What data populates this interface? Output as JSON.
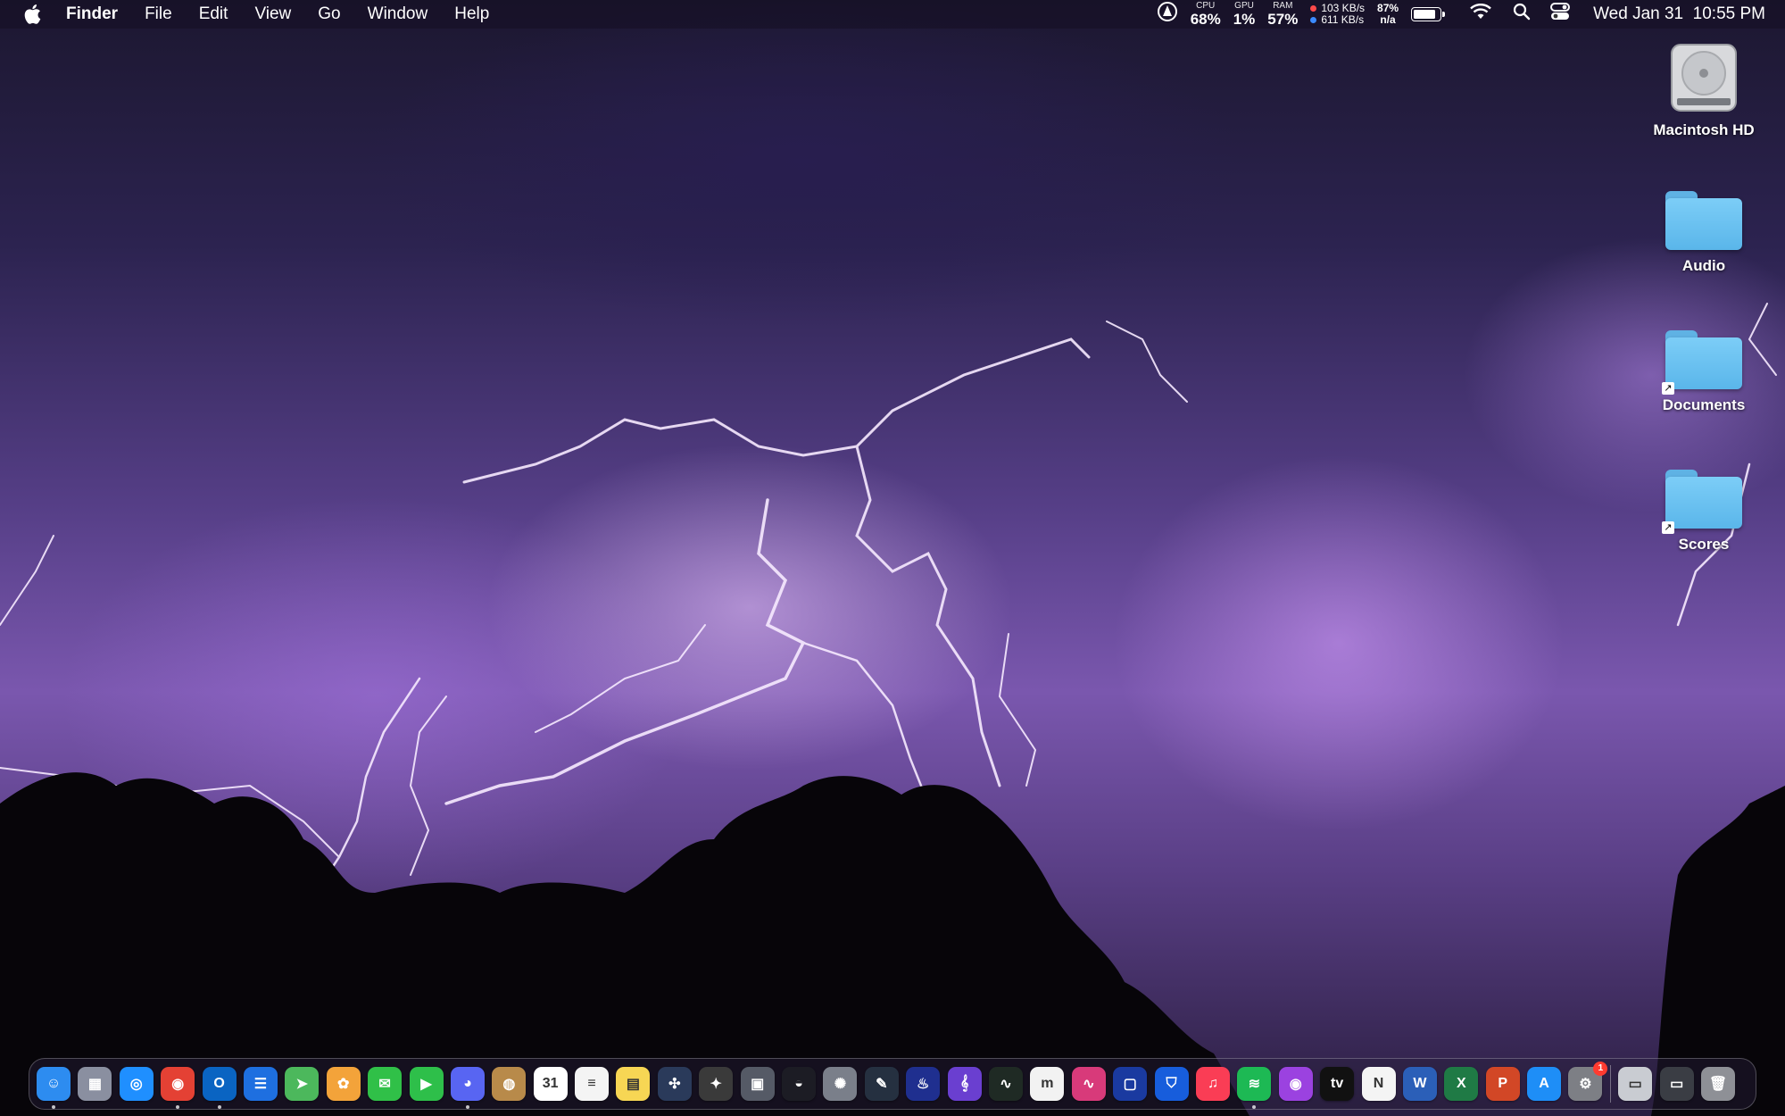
{
  "menubar": {
    "app_name": "Finder",
    "menus": [
      "File",
      "Edit",
      "View",
      "Go",
      "Window",
      "Help"
    ],
    "status": {
      "cpu_label": "CPU",
      "cpu_value": "68%",
      "gpu_label": "GPU",
      "gpu_value": "1%",
      "ram_label": "RAM",
      "ram_value": "57%",
      "net_up": "103 KB/s",
      "net_down": "611 KB/s",
      "battery_percent": "87%",
      "battery_time": "n/a",
      "battery_level": 0.87,
      "clock": "Wed Jan 31  10:55 PM"
    }
  },
  "desktop": {
    "icons": [
      {
        "label": "Macintosh HD",
        "icon": "hard-drive-icon"
      },
      {
        "label": "Audio",
        "icon": "folder-icon"
      },
      {
        "label": "Documents",
        "icon": "folder-alias-icon"
      },
      {
        "label": "Scores",
        "icon": "folder-alias-icon"
      }
    ]
  },
  "dock": {
    "apps": [
      {
        "name": "finder",
        "glyph": "☺",
        "color": "#2d8cf0",
        "running": true
      },
      {
        "name": "launchpad",
        "glyph": "▦",
        "color": "#8a8fa0",
        "running": false
      },
      {
        "name": "safari",
        "glyph": "◎",
        "color": "#1f8fff",
        "running": false
      },
      {
        "name": "chrome",
        "glyph": "◉",
        "color": "#e44134",
        "running": true
      },
      {
        "name": "outlook",
        "glyph": "O",
        "color": "#0a64c2",
        "running": true
      },
      {
        "name": "files",
        "glyph": "☰",
        "color": "#1e6fe0",
        "running": false
      },
      {
        "name": "maps",
        "glyph": "➤",
        "color": "#4cb85c",
        "running": false
      },
      {
        "name": "photos",
        "glyph": "✿",
        "color": "#f3a33a",
        "running": false
      },
      {
        "name": "messages",
        "glyph": "✉",
        "color": "#30c048",
        "running": false
      },
      {
        "name": "facetime",
        "glyph": "▶",
        "color": "#2ebf4a",
        "running": false
      },
      {
        "name": "discord",
        "glyph": "◕",
        "color": "#5865f2",
        "running": true
      },
      {
        "name": "archive",
        "glyph": "◍",
        "color": "#b88a4a",
        "running": false
      },
      {
        "name": "calendar",
        "glyph": "31",
        "color": "#ffffff",
        "running": false
      },
      {
        "name": "reminders",
        "glyph": "≡",
        "color": "#f4f4f4",
        "running": false
      },
      {
        "name": "notes",
        "glyph": "▤",
        "color": "#f7d654",
        "running": false
      },
      {
        "name": "davinci-resolve",
        "glyph": "✣",
        "color": "#2a3a5a",
        "running": false
      },
      {
        "name": "motion",
        "glyph": "✦",
        "color": "#3a3a3a",
        "running": false
      },
      {
        "name": "compressor",
        "glyph": "▣",
        "color": "#555a66",
        "running": false
      },
      {
        "name": "obs",
        "glyph": "◒",
        "color": "#1c1c24",
        "running": false
      },
      {
        "name": "fan-control",
        "glyph": "✺",
        "color": "#7a7f8a",
        "running": false
      },
      {
        "name": "logic-pro",
        "glyph": "✎",
        "color": "#253040",
        "running": false
      },
      {
        "name": "audio-app",
        "glyph": "♨",
        "color": "#1f2f8f",
        "running": false
      },
      {
        "name": "musescore",
        "glyph": "𝄞",
        "color": "#6a3fd0",
        "running": false
      },
      {
        "name": "activity-monitor",
        "glyph": "∿",
        "color": "#1f2a24",
        "running": false
      },
      {
        "name": "m-app",
        "glyph": "m",
        "color": "#f2f2f2",
        "running": false
      },
      {
        "name": "waveform-app",
        "glyph": "∿",
        "color": "#d83a7a",
        "running": false
      },
      {
        "name": "square-app",
        "glyph": "▢",
        "color": "#1a3aa0",
        "running": false
      },
      {
        "name": "bitwarden",
        "glyph": "⛉",
        "color": "#175ddc",
        "running": false
      },
      {
        "name": "music",
        "glyph": "♫",
        "color": "#fa3d55",
        "running": false
      },
      {
        "name": "spotify",
        "glyph": "≋",
        "color": "#1db954",
        "running": true
      },
      {
        "name": "podcasts",
        "glyph": "◉",
        "color": "#9b42e0",
        "running": false
      },
      {
        "name": "apple-tv",
        "glyph": "tv",
        "color": "#111111",
        "running": false
      },
      {
        "name": "news",
        "glyph": "N",
        "color": "#f4f4f4",
        "running": false
      },
      {
        "name": "word",
        "glyph": "W",
        "color": "#2b5fb8",
        "running": false
      },
      {
        "name": "excel",
        "glyph": "X",
        "color": "#1f7a45",
        "running": false
      },
      {
        "name": "powerpoint",
        "glyph": "P",
        "color": "#d24726",
        "running": false
      },
      {
        "name": "app-store",
        "glyph": "A",
        "color": "#1e8ef7",
        "running": false
      },
      {
        "name": "system-settings",
        "glyph": "⚙",
        "color": "#7d7f85",
        "running": false,
        "badge": "1"
      }
    ],
    "extras": [
      {
        "name": "downloads-stack",
        "glyph": "▭",
        "color": "#c9ccd2"
      },
      {
        "name": "recent-stack",
        "glyph": "▭",
        "color": "#3a3d44"
      },
      {
        "name": "trash",
        "glyph": "🗑",
        "color": "#8e9096"
      }
    ]
  }
}
